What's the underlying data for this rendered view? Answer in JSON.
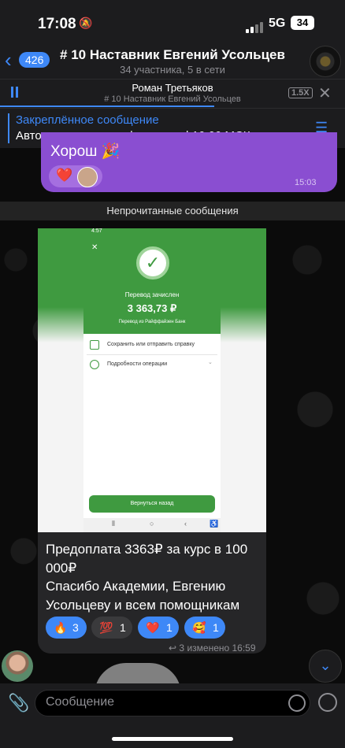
{
  "status_bar": {
    "time": "17:08",
    "network": "5G",
    "battery": "34"
  },
  "header": {
    "back_count": "426",
    "title": "# 10 Наставник Евгений Усольцев",
    "subtitle": "34 участника, 5 в сети"
  },
  "player": {
    "title": "Роман Третьяков",
    "subtitle": "# 10 Наставник Евгений Усольцев",
    "speed": "1.5X",
    "progress": 0.62
  },
  "pinned": {
    "label": "Закреплённое сообщение",
    "text": "Автоматическая конференция | 10:00 МСК по поне…"
  },
  "prev_message": {
    "text": "Хорош 🎉",
    "time": "15:03",
    "reaction": "❤️"
  },
  "unread_label": "Непрочитанные сообщения",
  "screenshot": {
    "status": "4:57",
    "title": "Перевод зачислен",
    "amount": "3 363,73 ₽",
    "from": "Перевод из Райффайзен Банк",
    "row1": "Сохранить или отправить справку",
    "row2": "Подробности операции",
    "button": "Вернуться назад"
  },
  "message": {
    "caption_line1": "Предоплата 3363₽ за курс в 100 000₽",
    "caption_line2": "Спасибо Академии, Евгению Усольцеву и всем помощникам",
    "reactions": [
      {
        "emoji": "🔥",
        "count": "3"
      },
      {
        "emoji": "💯",
        "count": "1"
      },
      {
        "emoji": "❤️",
        "count": "1"
      },
      {
        "emoji": "🥰",
        "count": "1"
      }
    ],
    "replies": "3",
    "meta": "изменено 16:59"
  },
  "input": {
    "placeholder": "Сообщение"
  },
  "colors": {
    "accent": "#3e88f7",
    "bubble_purple": "#8a4ed1",
    "bank_green": "#3f9a40"
  }
}
